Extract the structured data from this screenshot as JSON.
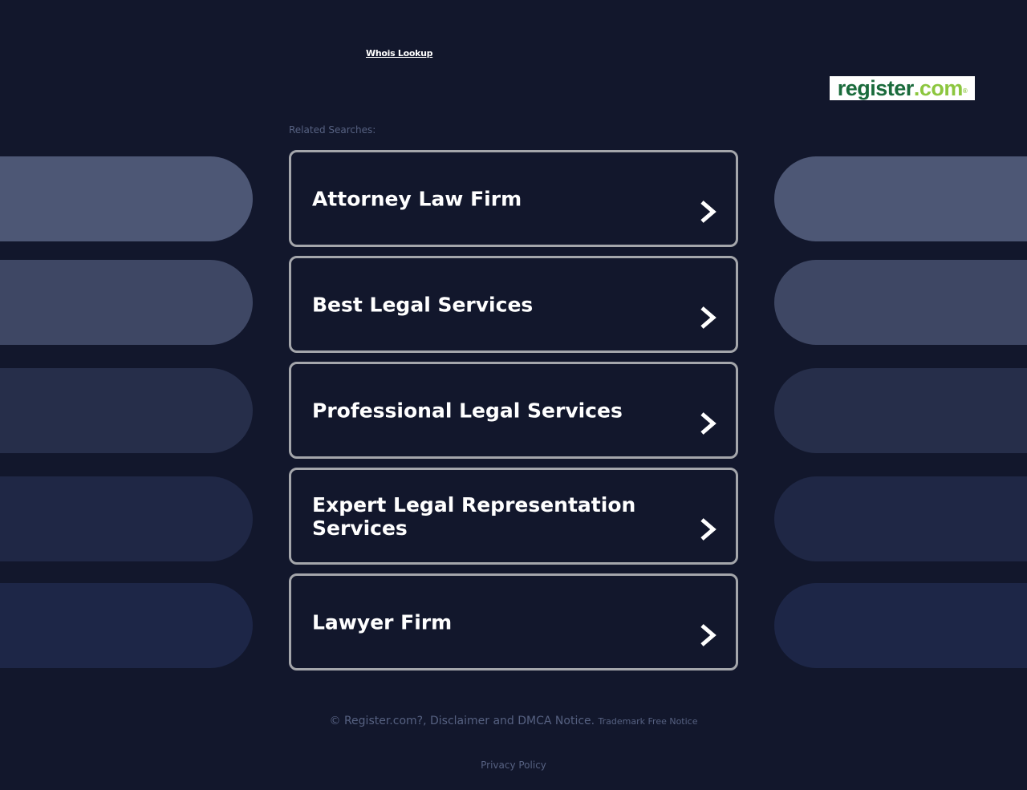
{
  "header": {
    "whois_link": "Whois Lookup",
    "logo": {
      "part1": "register",
      "part2": ".com",
      "tm": "®",
      "brand_green": "#1a6b3c",
      "brand_lime": "#8cc63f"
    }
  },
  "related": {
    "label": "Related Searches:",
    "items": [
      {
        "label": "Attorney Law Firm"
      },
      {
        "label": "Best Legal Services"
      },
      {
        "label": "Professional Legal Services"
      },
      {
        "label": "Expert Legal Representation Services"
      },
      {
        "label": "Lawyer Firm"
      }
    ]
  },
  "footer": {
    "copyright_text": "© Register.com?, Disclaimer and DMCA Notice.",
    "trademark_text": "Trademark Free Notice",
    "privacy": "Privacy Policy"
  },
  "colors": {
    "background": "#12172c",
    "card_border": "#a4a6ab",
    "muted_text": "#566181",
    "pill_shades": [
      "#4d5775",
      "#3e4764",
      "#262e4a",
      "#1f2745",
      "#1d2647"
    ]
  }
}
